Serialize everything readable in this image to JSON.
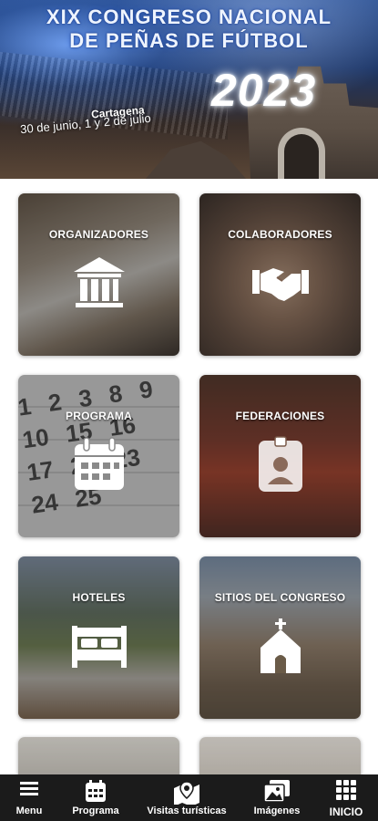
{
  "banner": {
    "title_line1": "XIX CONGRESO NACIONAL",
    "title_line2": "DE PEÑAS DE FÚTBOL",
    "year": "2023",
    "city": "Cartagena",
    "dates": "30 de junio, 1 y 2 de julio"
  },
  "tiles": [
    {
      "label": "ORGANIZADORES",
      "icon": "bank-building-icon"
    },
    {
      "label": "COLABORADORES",
      "icon": "handshake-icon"
    },
    {
      "label": "PROGRAMA",
      "icon": "calendar-icon"
    },
    {
      "label": "FEDERACIONES",
      "icon": "id-badge-icon"
    },
    {
      "label": "HOTELES",
      "icon": "bed-icon"
    },
    {
      "label": "SITIOS DEL CONGRESO",
      "icon": "chapel-icon"
    }
  ],
  "calendar_numbers": "1 2 3 8 9 10 15 16 17 22 23 24 25",
  "bottom_nav": {
    "menu": "Menu",
    "programa": "Programa",
    "visitas": "Visitas turísticas",
    "imagenes": "Imágenes",
    "inicio": "INICIO"
  },
  "colors": {
    "nav_background": "#1b1b1b",
    "tile_overlay": "rgba(20,20,20,0.38)",
    "text": "#ffffff"
  }
}
